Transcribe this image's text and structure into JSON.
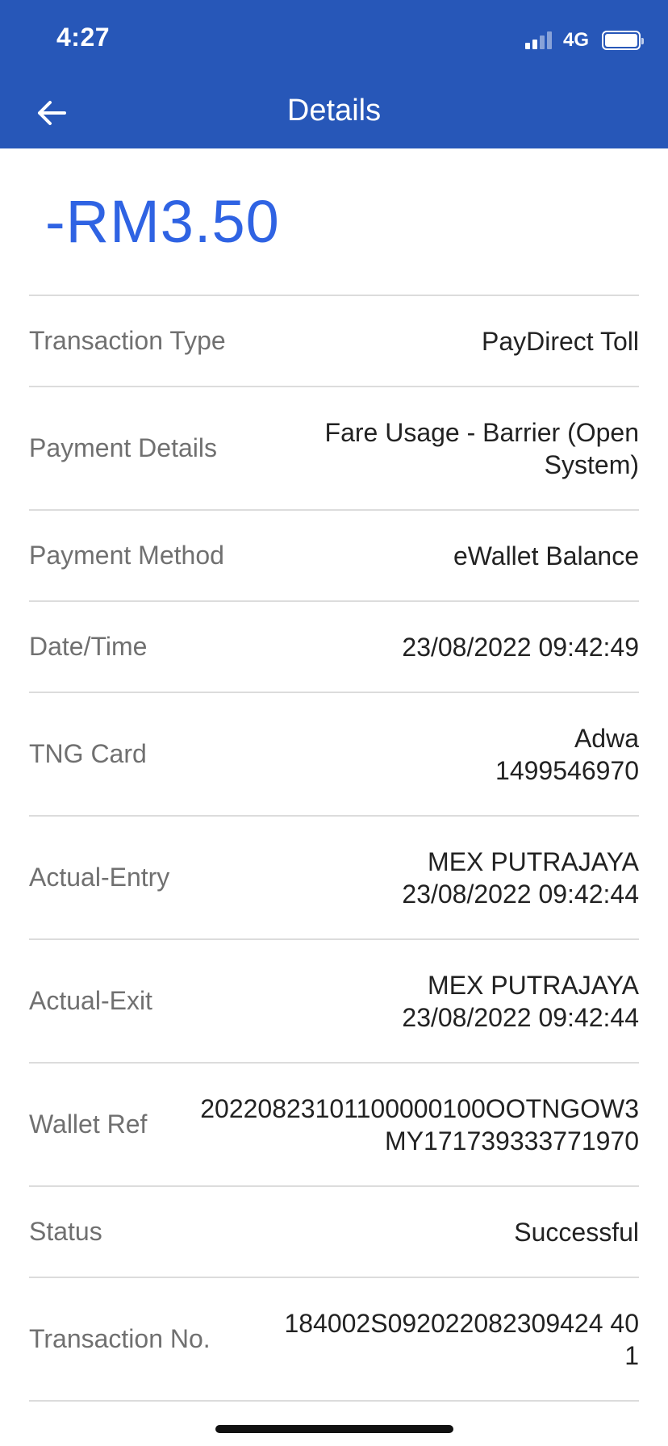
{
  "status_bar": {
    "time": "4:27",
    "network": "4G",
    "signal_icon": "signal-bars-icon",
    "battery_icon": "battery-icon"
  },
  "header": {
    "title": "Details",
    "back_icon": "arrow-left-icon",
    "background_color": "#2757b8"
  },
  "amount": {
    "value": "-RM3.50",
    "color": "#2f63e3"
  },
  "details": [
    {
      "label": "Transaction Type",
      "value_lines": [
        "PayDirect Toll"
      ]
    },
    {
      "label": "Payment Details",
      "value_lines": [
        "Fare Usage - Barrier (Open",
        "System)"
      ]
    },
    {
      "label": "Payment Method",
      "value_lines": [
        "eWallet Balance"
      ]
    },
    {
      "label": "Date/Time",
      "value_lines": [
        "23/08/2022 09:42:49"
      ]
    },
    {
      "label": "TNG Card",
      "value_lines": [
        "Adwa",
        "1499546970"
      ]
    },
    {
      "label": "Actual-Entry",
      "value_lines": [
        "MEX PUTRAJAYA",
        "23/08/2022 09:42:44"
      ]
    },
    {
      "label": "Actual-Exit",
      "value_lines": [
        "MEX PUTRAJAYA",
        "23/08/2022 09:42:44"
      ]
    },
    {
      "label": "Wallet Ref",
      "value_lines": [
        "20220823101100000100OOTNGOW3",
        "MY171739333771970"
      ]
    },
    {
      "label": "Status",
      "value_lines": [
        "Successful"
      ]
    },
    {
      "label": "Transaction No.",
      "value_lines": [
        "184002S092022082309424 40",
        "1"
      ]
    }
  ]
}
